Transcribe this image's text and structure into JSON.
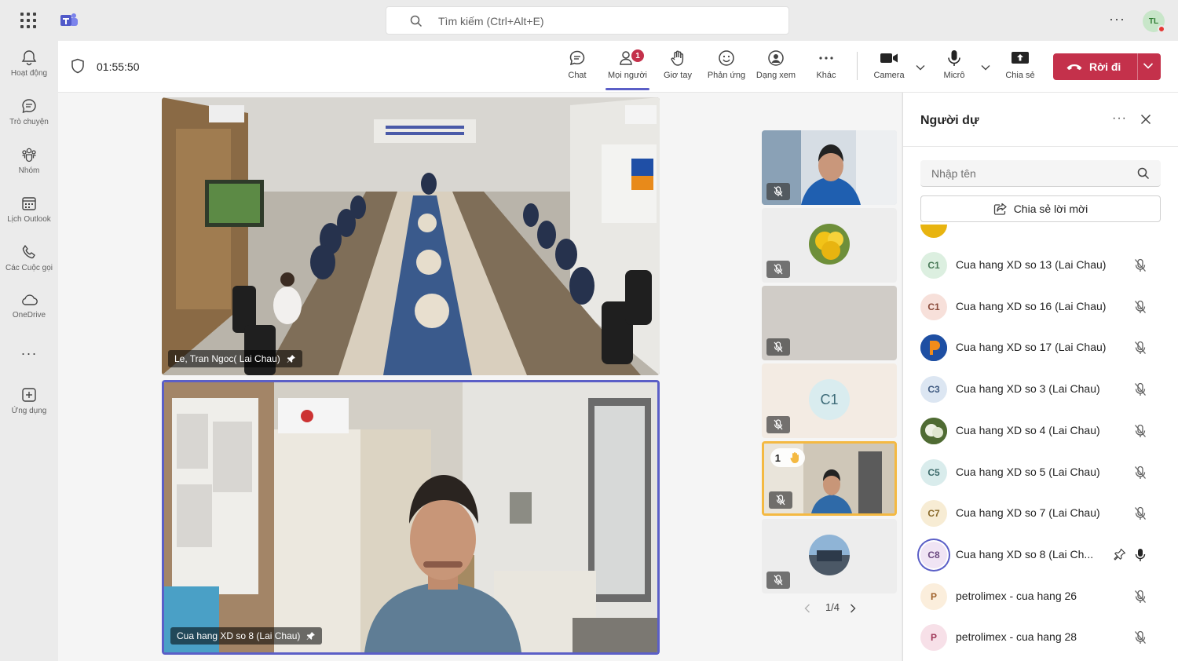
{
  "search": {
    "placeholder": "Tìm kiếm (Ctrl+Alt+E)"
  },
  "user": {
    "initials": "TL"
  },
  "rail": [
    {
      "label": "Hoạt động",
      "icon": "bell-icon"
    },
    {
      "label": "Trò chuyện",
      "icon": "chat-icon"
    },
    {
      "label": "Nhóm",
      "icon": "teams-icon"
    },
    {
      "label": "Lịch Outlook",
      "icon": "calendar-icon"
    },
    {
      "label": "Các Cuộc gọi",
      "icon": "phone-icon"
    },
    {
      "label": "OneDrive",
      "icon": "cloud-icon"
    },
    {
      "label": "Ứng dụng",
      "icon": "add-app-icon"
    }
  ],
  "meeting": {
    "timer": "01:55:50",
    "toolbar": {
      "chat": "Chat",
      "people": "Mọi người",
      "people_badge": "1",
      "raise": "Giơ tay",
      "react": "Phản ứng",
      "view": "Dạng xem",
      "more": "Khác",
      "camera": "Camera",
      "mic": "Micrô",
      "share": "Chia sẻ",
      "leave": "Rời đi"
    }
  },
  "stage": {
    "main_videos": [
      {
        "name": "Le, Tran Ngoc( Lai Chau)"
      },
      {
        "name": "Cua hang XD so 8 (Lai Chau)"
      }
    ],
    "thumbnails": [
      {
        "type": "video"
      },
      {
        "type": "avatar-image"
      },
      {
        "type": "blank"
      },
      {
        "type": "initials",
        "initials": "C1"
      },
      {
        "type": "video",
        "raised_hand": "1"
      },
      {
        "type": "avatar-image"
      }
    ],
    "pager": "1/4"
  },
  "panel": {
    "title": "Người dự",
    "search_placeholder": "Nhập tên",
    "invite_label": "Chia sẻ lời mời",
    "participants": [
      {
        "initials": "C1",
        "name": "Cua hang XD so 13 (Lai Chau)",
        "avatar_color": "#dcefe0",
        "text_color": "#4a7a58",
        "mic": "muted"
      },
      {
        "initials": "C1",
        "name": "Cua hang XD so 16 (Lai Chau)",
        "avatar_color": "#f7e0da",
        "text_color": "#8a4b3b",
        "mic": "muted"
      },
      {
        "initials": "",
        "name": "Cua hang XD so 17 (Lai Chau)",
        "avatar_color": "#1e4fa3",
        "text_color": "#ffffff",
        "mic": "muted",
        "logo": true
      },
      {
        "initials": "C3",
        "name": "Cua hang XD so 3 (Lai Chau)",
        "avatar_color": "#dce6f2",
        "text_color": "#3f5a80",
        "mic": "muted"
      },
      {
        "initials": "",
        "name": "Cua hang XD so 4 (Lai Chau)",
        "avatar_color": "#5a7a3a",
        "text_color": "#ffffff",
        "mic": "muted",
        "photo": true
      },
      {
        "initials": "C5",
        "name": "Cua hang XD so 5 (Lai Chau)",
        "avatar_color": "#d9ecec",
        "text_color": "#3d6b6b",
        "mic": "muted"
      },
      {
        "initials": "C7",
        "name": "Cua hang XD so 7 (Lai Chau)",
        "avatar_color": "#f7ecd4",
        "text_color": "#8a6a2b",
        "mic": "muted"
      },
      {
        "initials": "C8",
        "name": "Cua hang XD so 8 (Lai Ch...",
        "avatar_color": "#f0e4f4",
        "text_color": "#6b4a80",
        "mic": "on",
        "pinned": true,
        "speaking": true
      },
      {
        "initials": "P",
        "name": "petrolimex - cua hang 26",
        "avatar_color": "#fbeedc",
        "text_color": "#a0622b",
        "mic": "muted"
      },
      {
        "initials": "P",
        "name": "petrolimex - cua hang 28",
        "avatar_color": "#f7e0e8",
        "text_color": "#a03a5a",
        "mic": "muted"
      }
    ]
  },
  "colors": {
    "accent": "#5b5fc7",
    "leave": "#c4314b",
    "raised_hand": "#f4b942"
  }
}
